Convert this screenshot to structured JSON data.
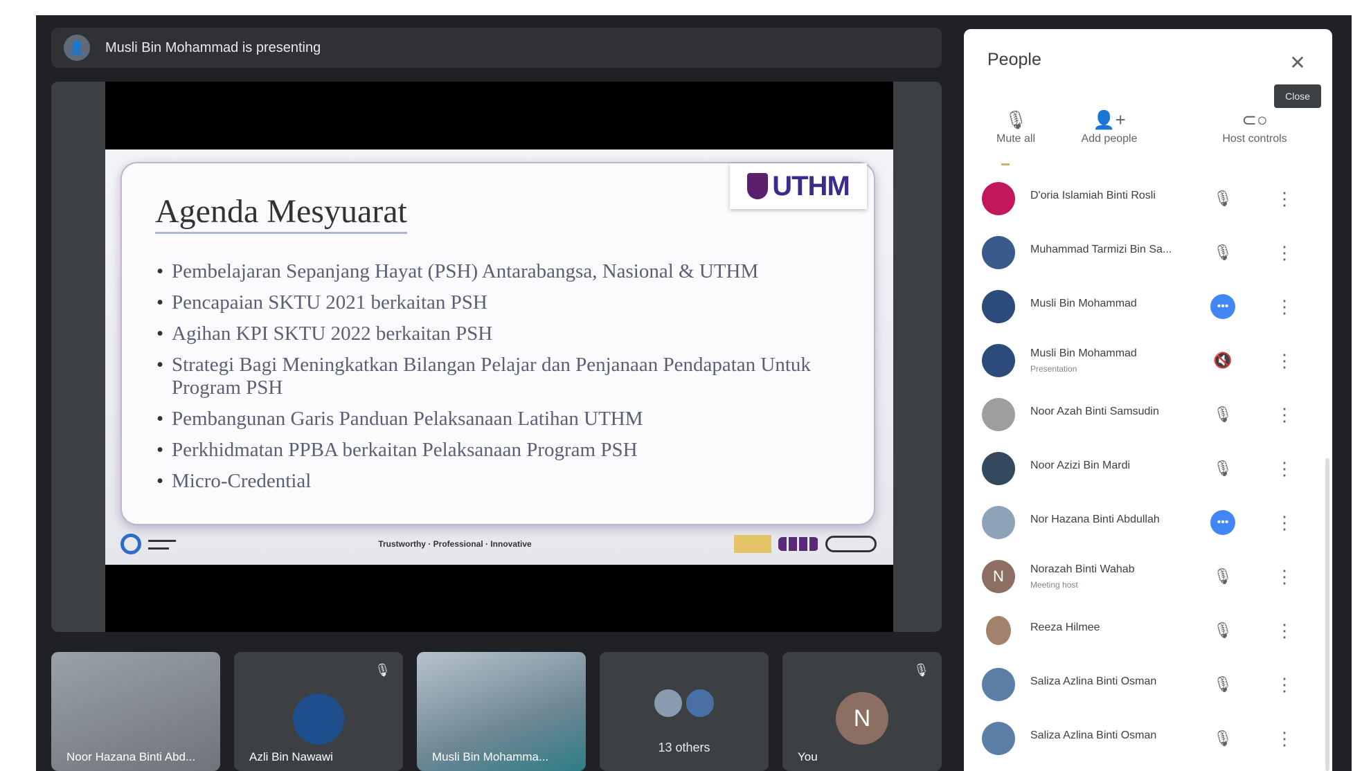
{
  "presenter_bar": {
    "text": "Musli Bin Mohammad is presenting"
  },
  "slide": {
    "logo_text": "UTHM",
    "title": "Agenda Mesyuarat",
    "items": [
      "Pembelajaran Sepanjang Hayat (PSH) Antarabangsa, Nasional & UTHM",
      "Pencapaian SKTU 2021 berkaitan PSH",
      "Agihan KPI SKTU 2022 berkaitan PSH",
      "Strategi Bagi Meningkatkan Bilangan Pelajar dan Penjanaan Pendapatan Untuk Program PSH",
      "Pembangunan Garis Panduan Pelaksanaan Latihan UTHM",
      "Perkhidmatan PPBA berkaitan Pelaksanaan Program PSH",
      "Micro-Credential"
    ],
    "footer_center": "Trustworthy · Professional · Innovative"
  },
  "tiles": [
    {
      "name": "Noor Hazana Binti Abd..."
    },
    {
      "name": "Azli Bin Nawawi"
    },
    {
      "name": "Musli Bin Mohamma..."
    },
    {
      "name": "13 others"
    },
    {
      "name": "You",
      "initial": "N"
    }
  ],
  "panel": {
    "title": "People",
    "close_tooltip": "Close",
    "actions": {
      "mute_all": "Mute all",
      "add_people": "Add people",
      "host_controls": "Host controls"
    },
    "people": [
      {
        "name": "D'oria Islamiah Binti Rosli",
        "sub": "",
        "status": "muted"
      },
      {
        "name": "Muhammad Tarmizi Bin Sa...",
        "sub": "",
        "status": "muted"
      },
      {
        "name": "Musli Bin Mohammad",
        "sub": "",
        "status": "speaking"
      },
      {
        "name": "Musli Bin Mohammad",
        "sub": "Presentation",
        "status": "presentation"
      },
      {
        "name": "Noor Azah Binti Samsudin",
        "sub": "",
        "status": "muted"
      },
      {
        "name": "Noor Azizi Bin Mardi",
        "sub": "",
        "status": "muted"
      },
      {
        "name": "Nor Hazana Binti Abdullah",
        "sub": "",
        "status": "speaking"
      },
      {
        "name": "Norazah Binti Wahab",
        "sub": "Meeting host",
        "status": "muted",
        "initial": "N"
      },
      {
        "name": "Reeza Hilmee",
        "sub": "",
        "status": "muted"
      },
      {
        "name": "Saliza Azlina Binti Osman",
        "sub": "",
        "status": "muted"
      },
      {
        "name": "Saliza Azlina Binti Osman",
        "sub": "",
        "status": "muted"
      }
    ]
  },
  "colors": {
    "background": "#202124",
    "tile": "#3c4043",
    "accent_blue": "#4285f4",
    "uthm_purple": "#3d2a8c"
  }
}
